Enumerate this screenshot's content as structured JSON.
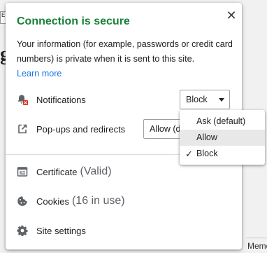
{
  "background_page": {
    "top_fragment": "ET",
    "glyph_fragment": "g",
    "bottom_fragment": "Memo"
  },
  "bubble": {
    "title": "Connection is secure",
    "close_icon": "close-icon",
    "description": "Your information (for example, passwords or credit card numbers) is private when it is sent to this site.",
    "learn_more": "Learn more",
    "title_color": "#188038",
    "link_color": "#1a73e8"
  },
  "permissions": {
    "notifications": {
      "label": "Notifications",
      "value": "Block",
      "icon": "notifications-blocked-icon"
    },
    "popups": {
      "label": "Pop-ups and redirects",
      "value": "Allow (default)",
      "icon": "popup-icon"
    }
  },
  "dropdown": {
    "options": [
      "Ask (default)",
      "Allow",
      "Block"
    ],
    "selected": "Block",
    "hovered": "Allow"
  },
  "links": {
    "certificate": {
      "label": "Certificate",
      "sub": "(Valid)",
      "icon": "certificate-icon"
    },
    "cookies": {
      "label": "Cookies",
      "sub": "(16 in use)",
      "icon": "cookie-icon"
    },
    "site_settings": {
      "label": "Site settings",
      "icon": "gear-icon"
    }
  }
}
